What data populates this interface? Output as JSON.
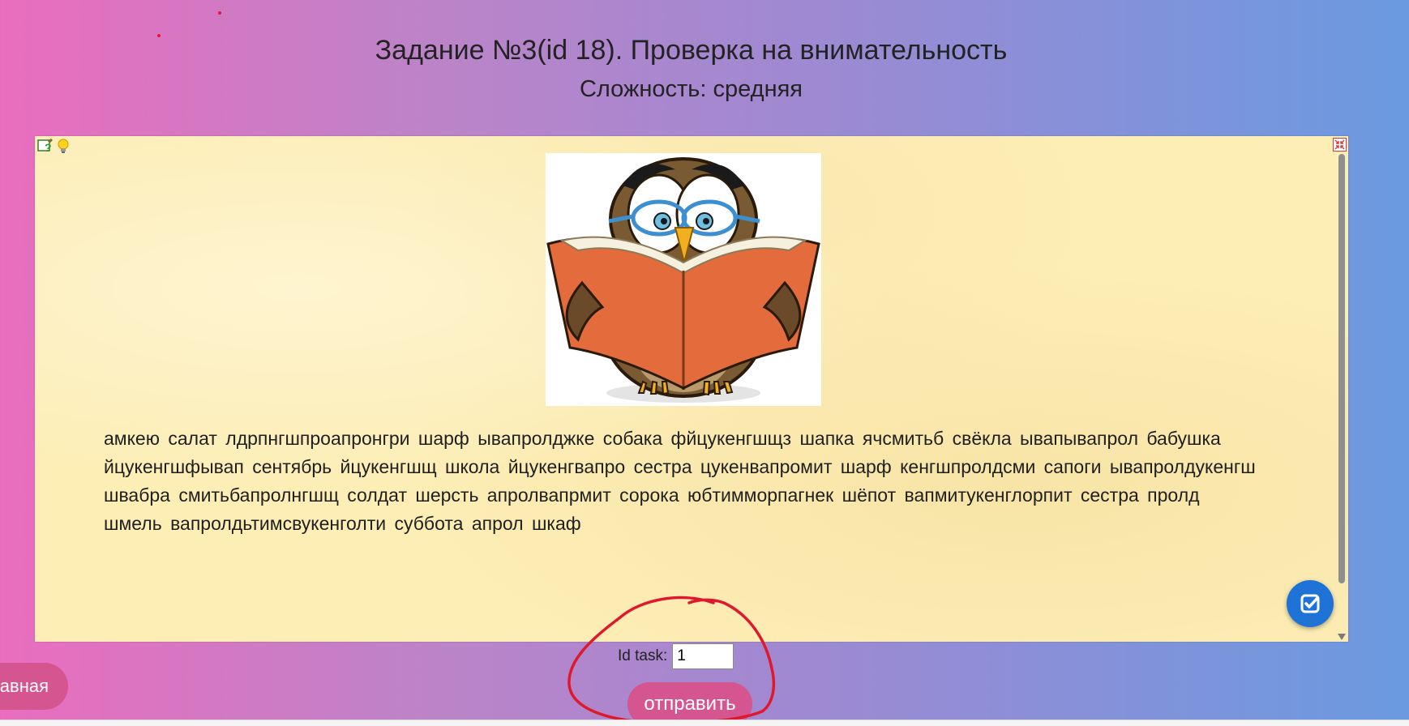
{
  "page": {
    "title": "Задание №3(id 18). Проверка на внимательность",
    "subtitle": "Сложность: средняя"
  },
  "panel": {
    "help_icon": "help-question-icon",
    "hint_icon": "lightbulb-icon",
    "fullscreen_icon": "collapse-fullscreen-icon",
    "image": "owl-reading-book",
    "text": "амкею салат лдрпнгшпроапронгри шарф ывапролджке собака фйцукенгшщз шапка ячсмитьб свёкла ывапывапрол бабушка йцукенгшфывап сентябрь йцукенгшщ школа йцукенгвапро сестра цукенвапромит шарф кенгшпролдсми сапоги ывапролдукенгш швабра смитьбапролнгшщ солдат шерсть апролвапрмит сорока юбтимморпагнек шёпот вапмитукенглорпит сестра пролд шмель вапролдьтимсвукенголти суббота апрол шкаф",
    "check_icon": "check-square-icon"
  },
  "nav": {
    "home_label": "авная"
  },
  "form": {
    "id_label": "Id task:",
    "id_value": "1",
    "submit_label": "отправить"
  },
  "colors": {
    "panel_bg": "#fdeeb6",
    "accent_pink": "#d4558f",
    "check_blue": "#1f73d6",
    "annotation_red": "#e0182e"
  }
}
